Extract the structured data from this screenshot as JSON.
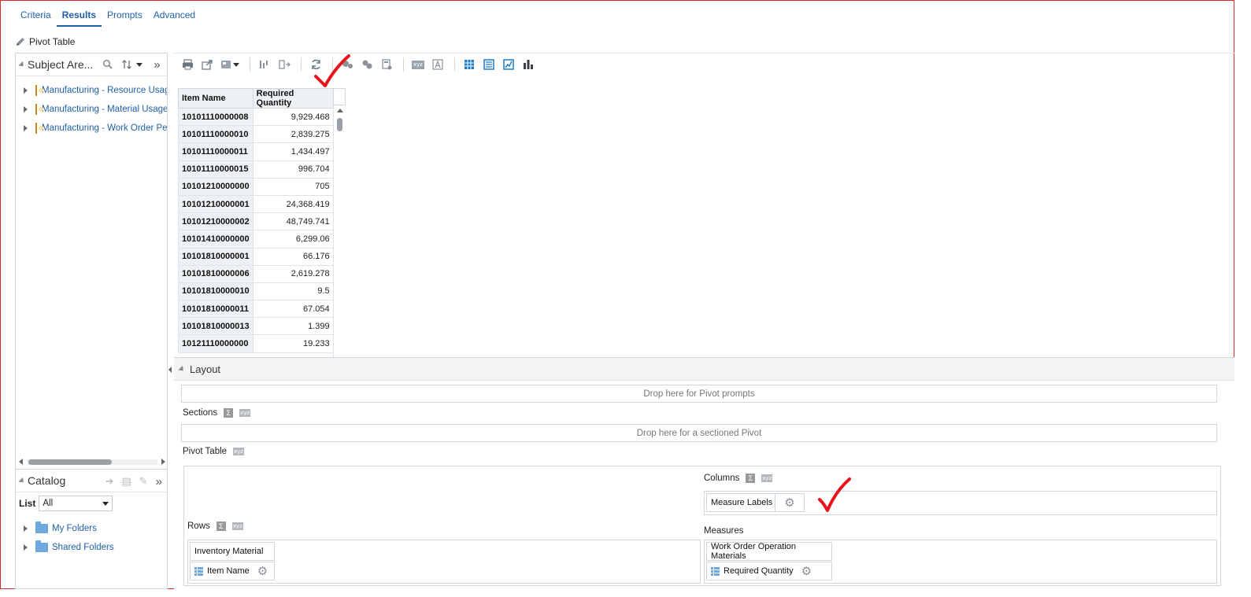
{
  "tabs": [
    {
      "label": "Criteria",
      "active": false
    },
    {
      "label": "Results",
      "active": true
    },
    {
      "label": "Prompts",
      "active": false
    },
    {
      "label": "Advanced",
      "active": false
    }
  ],
  "view_title": "Pivot Table",
  "subject_area": {
    "title": "Subject Are...",
    "items": [
      "Manufacturing - Resource Usag",
      "Manufacturing - Material Usage",
      "Manufacturing - Work Order Pe"
    ]
  },
  "catalog": {
    "title": "Catalog",
    "list_label": "List",
    "list_value": "All",
    "folders": [
      "My Folders",
      "Shared Folders"
    ]
  },
  "results_table": {
    "headers": [
      "Item Name",
      "Required Quantity"
    ],
    "rows": [
      [
        "10101110000008",
        "9,929.468"
      ],
      [
        "10101110000010",
        "2,839.275"
      ],
      [
        "10101110000011",
        "1,434.497"
      ],
      [
        "10101110000015",
        "996.704"
      ],
      [
        "10101210000000",
        "705"
      ],
      [
        "10101210000001",
        "24,368.419"
      ],
      [
        "10101210000002",
        "48,749.741"
      ],
      [
        "10101410000000",
        "6,299.06"
      ],
      [
        "10101810000001",
        "66.176"
      ],
      [
        "10101810000006",
        "2,619.278"
      ],
      [
        "10101810000010",
        "9.5"
      ],
      [
        "10101810000011",
        "67.054"
      ],
      [
        "10101810000013",
        "1.399"
      ],
      [
        "10121110000000",
        "19.233"
      ]
    ]
  },
  "layout": {
    "title": "Layout",
    "drop_prompts": "Drop here for Pivot prompts",
    "sections_label": "Sections",
    "drop_sections": "Drop here for a sectioned Pivot",
    "pivot_label": "Pivot Table",
    "columns_label": "Columns",
    "columns_item": "Measure Labels",
    "rows_label": "Rows",
    "rows_folder": "Inventory Material",
    "rows_item": "Item Name",
    "measures_label": "Measures",
    "measures_folder": "Work Order Operation Materials",
    "measures_item": "Required Quantity",
    "sigma": "Σ",
    "xyz": "xyz"
  },
  "colors": {
    "link": "#1f5fa8",
    "annotation_red": "#e8141c",
    "header_bg": "#eef1f4"
  }
}
